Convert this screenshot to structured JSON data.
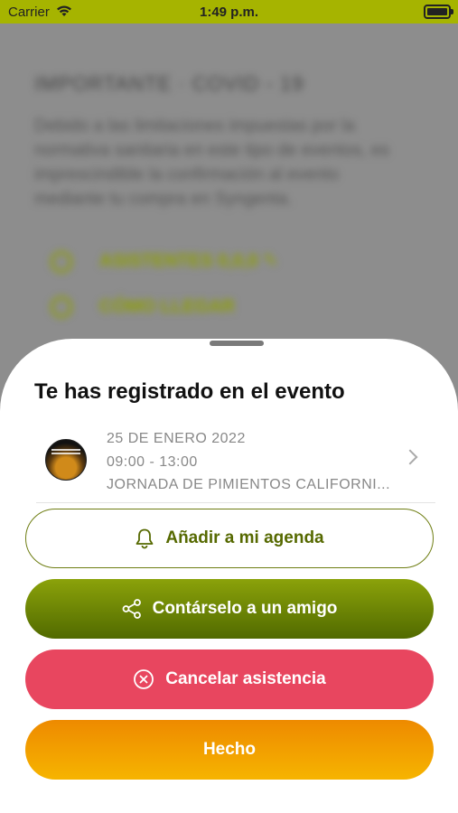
{
  "status_bar": {
    "carrier": "Carrier",
    "time": "1:49 p.m."
  },
  "background": {
    "title": "IMPORTANTE · COVID - 19",
    "paragraph": "Debido a las limitaciones impuestas por la normativa sanitaria en este tipo de eventos, es imprescindible la confirmación al evento mediante tu compra en Syngenta.",
    "link1": "ASISTENTES 0,0,0 ✎",
    "link2": "CÓMO LLEGAR"
  },
  "sheet": {
    "title": "Te has registrado en el evento",
    "event": {
      "date": "25 DE ENERO 2022",
      "time": "09:00 - 13:00",
      "name": "JORNADA DE PIMIENTOS CALIFORNI..."
    },
    "buttons": {
      "agenda": "Añadir a mi agenda",
      "share": "Contárselo a un amigo",
      "cancel": "Cancelar asistencia",
      "done": "Hecho"
    }
  },
  "colors": {
    "status_bar": "#a6b400",
    "brand_green": "#6e7d12",
    "cancel_red": "#e8465f",
    "done_orange": "#f2a000"
  }
}
